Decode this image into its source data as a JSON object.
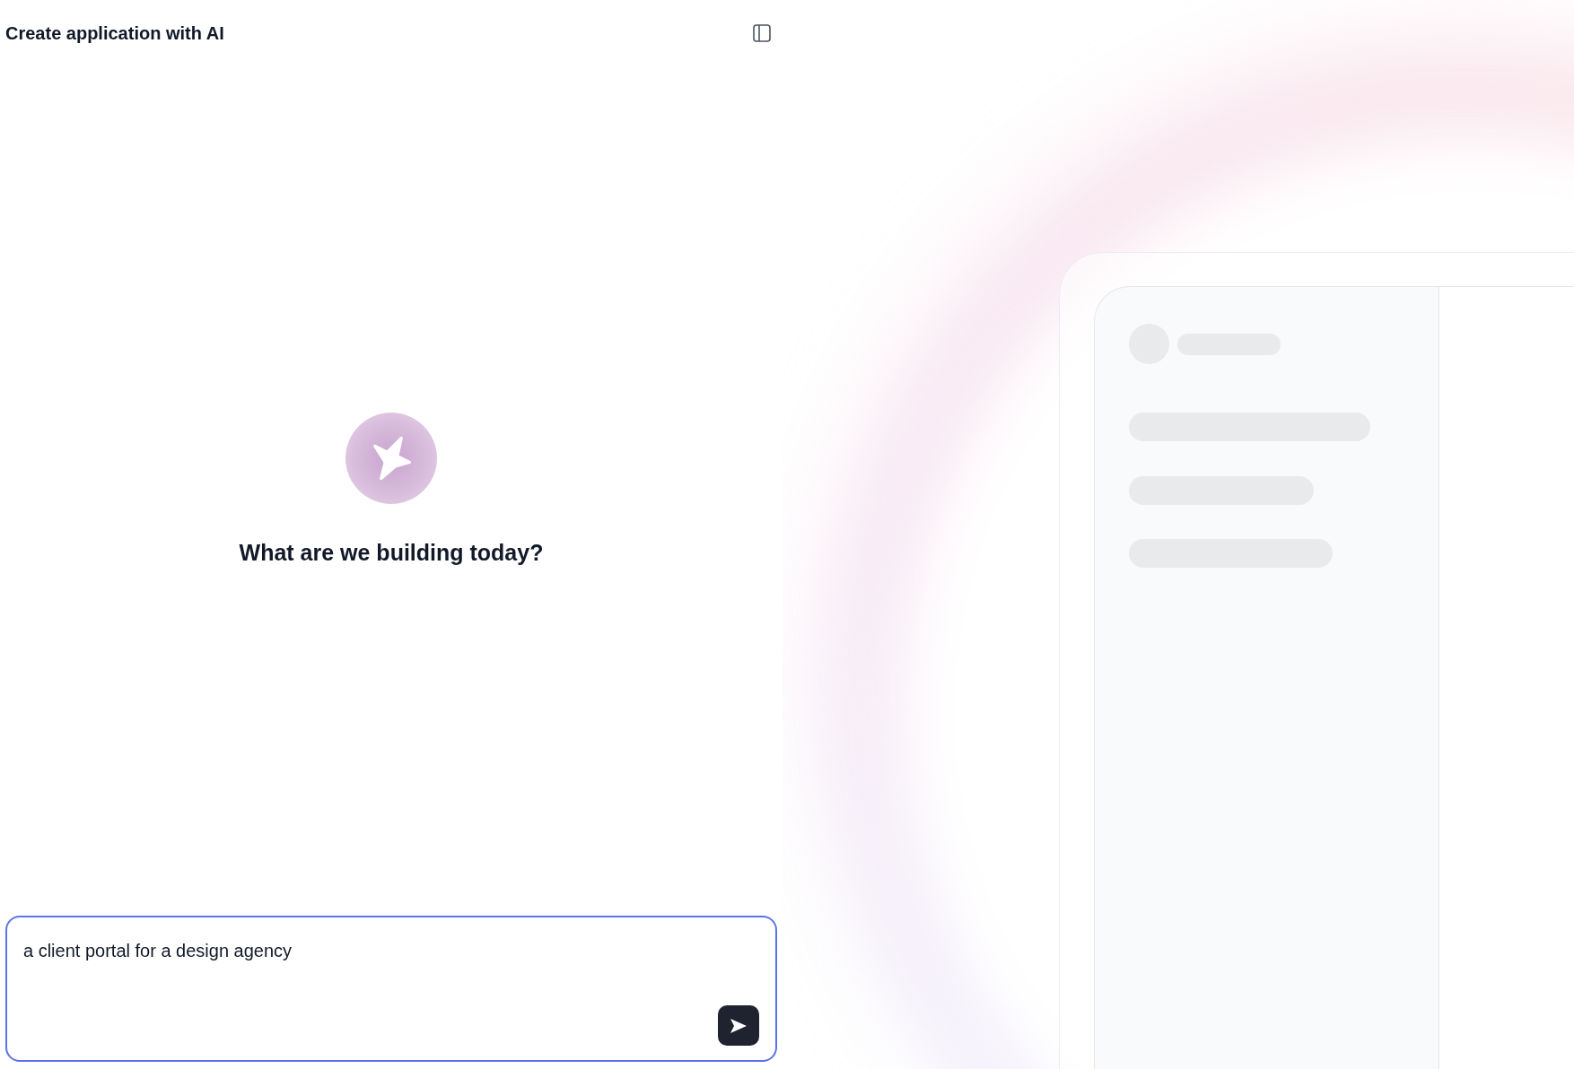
{
  "header": {
    "title": "Create application with AI"
  },
  "prompt": {
    "heading": "What are we building today?"
  },
  "composer": {
    "value": "a client portal for a design agency",
    "focused": true
  }
}
